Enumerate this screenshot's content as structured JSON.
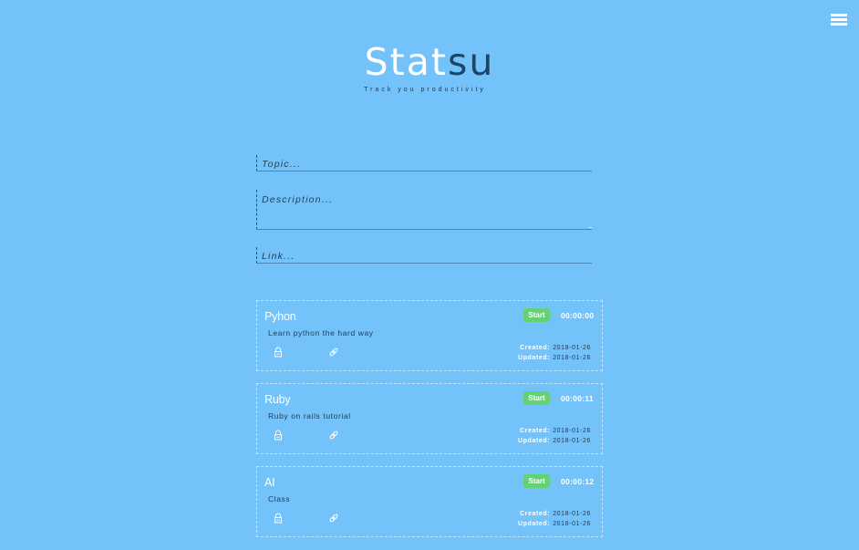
{
  "app": {
    "title_part1": "Stat",
    "title_part2": "su",
    "tagline": "Track you productivity"
  },
  "form": {
    "topic_placeholder": "Topic...",
    "description_placeholder": "Description...",
    "link_placeholder": "Link..."
  },
  "labels": {
    "start": "Start",
    "created": "Created:",
    "updated": "Updated:"
  },
  "tasks": [
    {
      "title": "Pyhon",
      "description": "Learn python the hard way",
      "timer": "00:00:00",
      "created": "2018-01-26",
      "updated": "2018-01-26"
    },
    {
      "title": "Ruby",
      "description": "Ruby on rails tutorial",
      "timer": "00:00:11",
      "created": "2018-01-26",
      "updated": "2018-01-26"
    },
    {
      "title": "AI",
      "description": "Class",
      "timer": "00:00:12",
      "created": "2018-01-26",
      "updated": "2018-01-26"
    }
  ],
  "icons": {
    "menu": "hamburger-menu-icon",
    "lock": "lock-icon",
    "link": "link-icon"
  },
  "colors": {
    "background": "#73c2fa",
    "start_button": "#63d275",
    "logo_accent": "#1d4566"
  }
}
